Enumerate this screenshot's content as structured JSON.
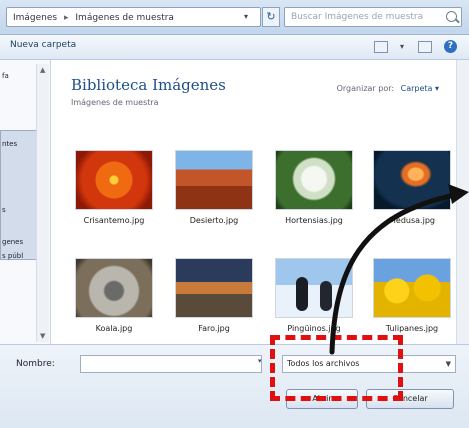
{
  "address_bar": {
    "crumbs": [
      "Imágenes",
      "Imágenes de muestra"
    ],
    "separator": "▸",
    "search_placeholder": "Buscar Imágenes de muestra"
  },
  "toolbar": {
    "new_folder": "Nueva carpeta"
  },
  "navigation": {
    "items": [
      "fa",
      "ntes",
      "s",
      "genes",
      "s públ"
    ]
  },
  "library": {
    "title": "Biblioteca Imágenes",
    "subtitle": "Imágenes de muestra",
    "arrange_label": "Organizar por:",
    "arrange_value": "Carpeta ▾"
  },
  "files": [
    {
      "name": "Crisantemo.jpg",
      "image": "chrysanthemum"
    },
    {
      "name": "Desierto.jpg",
      "image": "desert"
    },
    {
      "name": "Hortensias.jpg",
      "image": "hydrangeas"
    },
    {
      "name": "Medusa.jpg",
      "image": "jellyfish"
    },
    {
      "name": "Koala.jpg",
      "image": "koala"
    },
    {
      "name": "Faro.jpg",
      "image": "lighthouse"
    },
    {
      "name": "Pingüinos.jpg",
      "image": "penguins"
    },
    {
      "name": "Tulipanes.jpg",
      "image": "tulips"
    }
  ],
  "bottom_bar": {
    "name_label": "Nombre:",
    "name_value": "",
    "filter_value": "Todos los archivos",
    "open_button": "Abrir",
    "cancel_button": "Cancelar"
  },
  "colors": {
    "highlight": "#e01010",
    "arrow": "#111111"
  }
}
